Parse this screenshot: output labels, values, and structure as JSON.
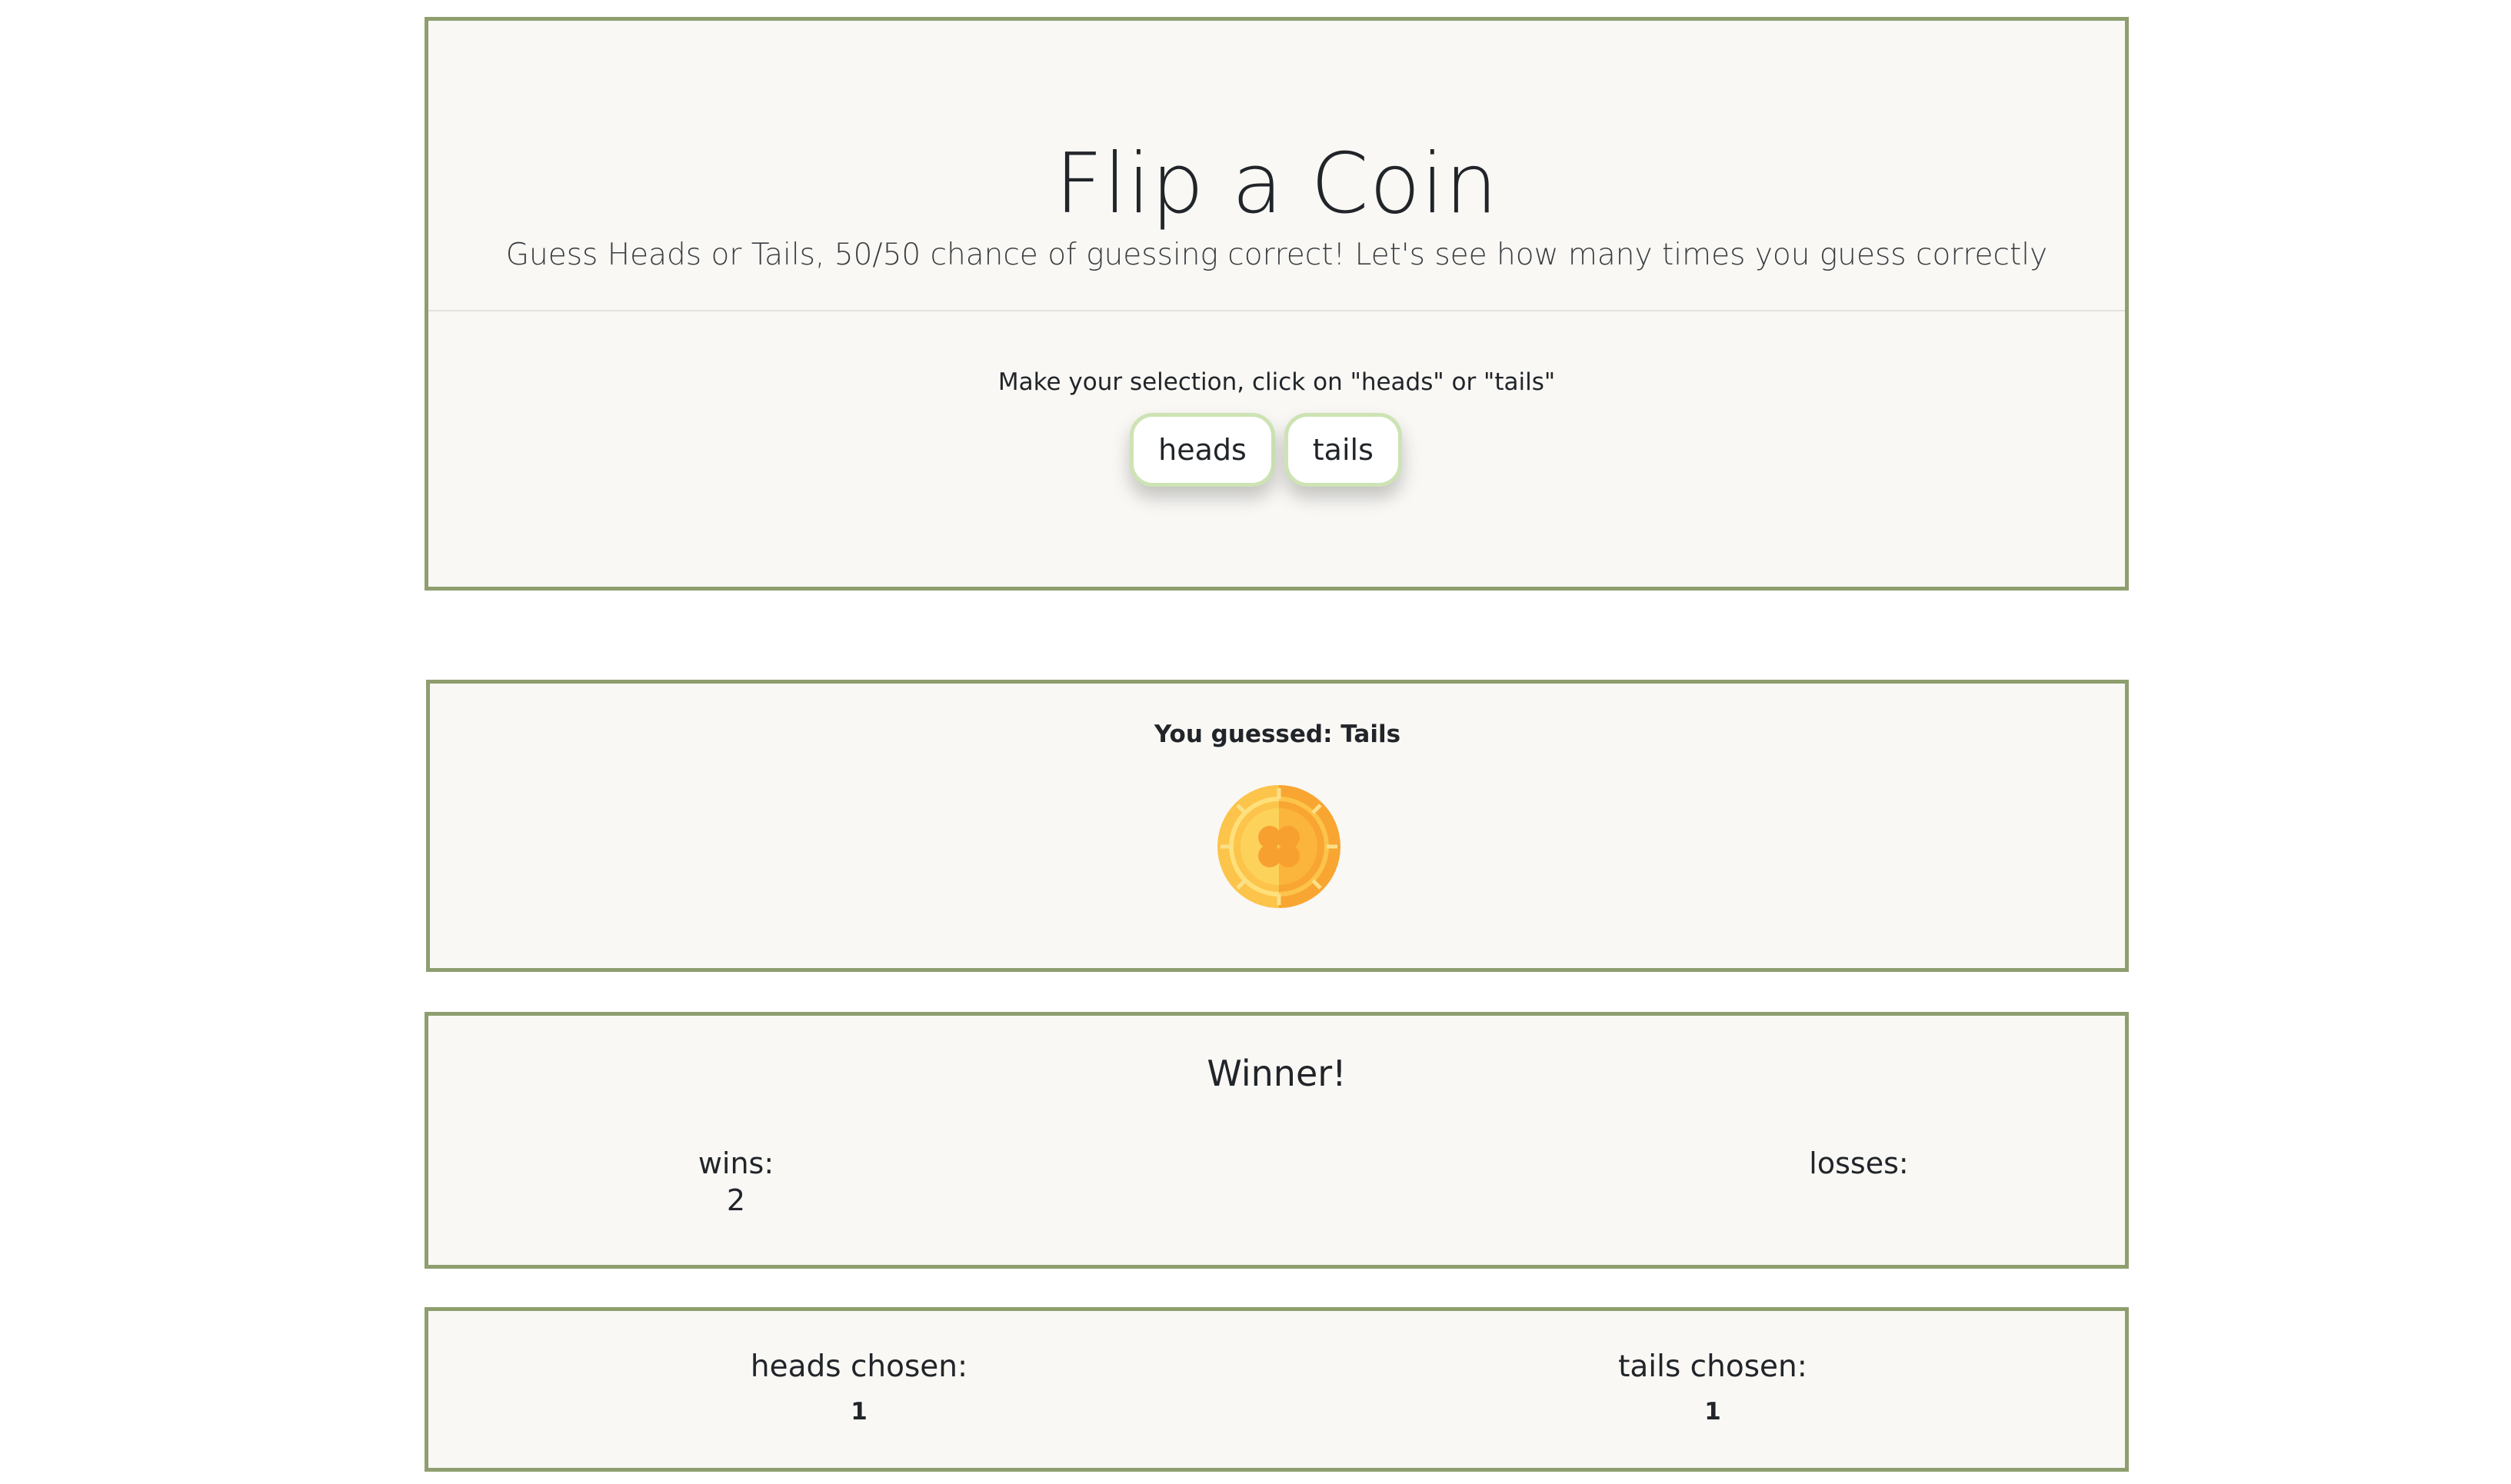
{
  "hero": {
    "title": "Flip a Coin",
    "subtitle": "Guess Heads or Tails, 50/50 chance of guessing correct! Let's see how many times you guess correctly",
    "instructions": "Make your selection, click on \"heads\" or \"tails\"",
    "buttons": {
      "heads": "heads",
      "tails": "tails"
    }
  },
  "guess": {
    "prefix": "You guessed:",
    "value": "Tails",
    "coin_icon": "gold-clover-coin-icon"
  },
  "result": {
    "heading": "Winner!",
    "wins_label": "wins:",
    "wins_value": "2",
    "losses_label": "losses:",
    "losses_value": ""
  },
  "choices": {
    "heads_label": "heads chosen:",
    "heads_value": "1",
    "tails_label": "tails chosen:",
    "tails_value": "1"
  },
  "colors": {
    "panel_border": "#8e9e6e",
    "panel_background": "#f9f8f5",
    "button_border": "#cde3b4",
    "coin_gold": "#f9b33a"
  }
}
